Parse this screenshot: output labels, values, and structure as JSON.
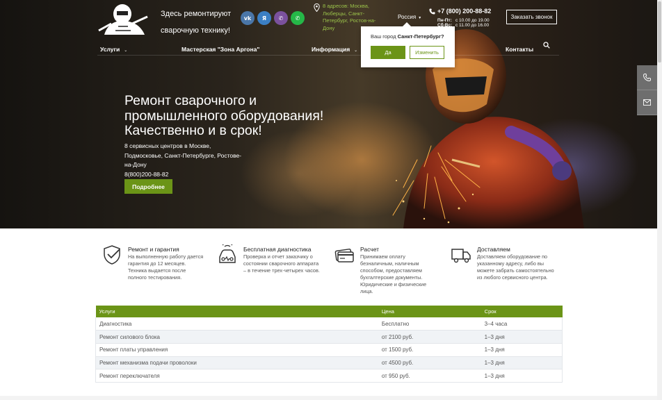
{
  "header": {
    "tagline": "Здесь ремонтируют сварочную технику!",
    "socials": [
      {
        "name": "vk",
        "label": "vk",
        "color": "#4a76a8"
      },
      {
        "name": "yandex",
        "label": "Я",
        "color": "#3b7fc4"
      },
      {
        "name": "viber",
        "label": "✆",
        "color": "#7b519d"
      },
      {
        "name": "whatsapp",
        "label": "✆",
        "color": "#25b748"
      }
    ],
    "address": "8 адресов: Москва, Люберцы, Санкт-Петербург, Ростов-на-Дону",
    "region": "Россия",
    "phone": "+7 (800) 200-88-82",
    "hours": [
      {
        "days": "Пн-Пт:",
        "time": "с 10.00 до 19.00"
      },
      {
        "days": "Сб-Вс:",
        "time": "с 11.00 до 16.00"
      }
    ],
    "callback_label": "Заказать звонок"
  },
  "nav": {
    "items": [
      {
        "label": "Услуги",
        "dropdown": true
      },
      {
        "label": "Мастерская \"Зона Аргона\"",
        "dropdown": false
      },
      {
        "label": "Информация",
        "dropdown": true
      },
      {
        "label": "Контакты",
        "dropdown": false
      }
    ]
  },
  "city_popup": {
    "question": "Ваш город",
    "city": "Санкт-Петербург?",
    "yes_label": "Да",
    "change_label": "Изменить"
  },
  "hero": {
    "title": "Ремонт сварочного и промышленного оборудования! Качественно и в срок!",
    "subtitle": "8 сервисных центров в Москве, Подмосковье, Санкт-Петербурге, Ростове-на-Дону",
    "phone": "8(800)200-88-82",
    "button_label": "Подробнее"
  },
  "features": [
    {
      "icon": "shield-check-icon",
      "title": "Ремонт и гарантия",
      "text": "На выполненную работу дается гарантия до 12 месяцев. Техника выдается после полного тестирования."
    },
    {
      "icon": "car-diagnostics-icon",
      "title": "Бесплатная диагностика",
      "text": "Проверка и отчет заказчику о состоянии сварочного аппарата – в течение трех-четырех часов."
    },
    {
      "icon": "payment-card-icon",
      "title": "Расчет",
      "text": "Принимаем оплату безналичным, наличным способом, предоставляем бухгалтерские документы. Юридические и физические лица."
    },
    {
      "icon": "delivery-truck-icon",
      "title": "Доставляем",
      "text": "Доставляем оборудование по указанному адресу, либо вы можете забрать самостоятельно из любого сервисного центра."
    }
  ],
  "price_table": {
    "headers": [
      "Услуги",
      "Цена",
      "Срок"
    ],
    "rows": [
      [
        "Диагностика",
        "Бесплатно",
        "3–4 часа"
      ],
      [
        "Ремонт силового блока",
        "от 2100 руб.",
        "1–3 дня"
      ],
      [
        "Ремонт платы управления",
        "от 1500 руб.",
        "1–3 дня"
      ],
      [
        "Ремонт механизма подачи проволоки",
        "от 4500 руб.",
        "1–3 дня"
      ],
      [
        "Ремонт переключателя",
        "от 950 руб.",
        "1–3 дня"
      ]
    ]
  },
  "side_widgets": [
    {
      "icon": "phone-icon"
    },
    {
      "icon": "mail-icon"
    }
  ],
  "colors": {
    "accent": "#6b9417",
    "address": "#9ac24a"
  }
}
